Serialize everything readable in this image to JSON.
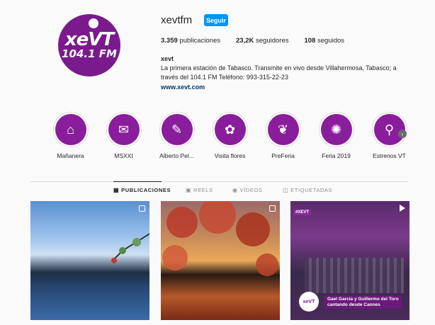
{
  "profile": {
    "username": "xevtfm",
    "follow_label": "Seguir",
    "avatar_brand": "xeVT",
    "avatar_freq": "104.1 FM",
    "stats": [
      {
        "value": "3.359",
        "label": "publicaciones"
      },
      {
        "value": "23,2K",
        "label": "seguidores"
      },
      {
        "value": "108",
        "label": "seguidos"
      }
    ],
    "bio_name": "xevt",
    "bio_text": "La primera estación de Tabasco. Transmite en vivo desde Villahermosa, Tabasco; a través del 104.1 FM Teléfono: 993-315-22-23",
    "bio_link": "www.xevt.com"
  },
  "highlights": [
    {
      "label": "Mañanera",
      "icon": "podium-icon",
      "glyph": "⌂"
    },
    {
      "label": "MSXXI",
      "icon": "chat-icon",
      "glyph": "✉"
    },
    {
      "label": "Alberto Pel...",
      "icon": "microphone-icon",
      "glyph": "✎"
    },
    {
      "label": "Visita flores",
      "icon": "flower-icon",
      "glyph": "✿"
    },
    {
      "label": "PreFeria",
      "icon": "leaf-icon",
      "glyph": "❦"
    },
    {
      "label": "Feria 2019",
      "icon": "ferris-wheel-icon",
      "glyph": "✺"
    },
    {
      "label": "Estrenos VT",
      "icon": "antenna-icon",
      "glyph": "⚲"
    }
  ],
  "tabs": [
    {
      "label": "PUBLICACIONES",
      "icon": "grid-icon",
      "glyph": "▦",
      "active": true
    },
    {
      "label": "REELS",
      "icon": "reels-icon",
      "glyph": "▣",
      "active": false
    },
    {
      "label": "VÍDEOS",
      "icon": "video-icon",
      "glyph": "◉",
      "active": false
    },
    {
      "label": "ETIQUETADAS",
      "icon": "tagged-icon",
      "glyph": "◫",
      "active": false
    }
  ],
  "posts": [
    {
      "type": "carousel"
    },
    {
      "type": "carousel"
    },
    {
      "type": "video",
      "tag": "#XEVT",
      "caption_line1": "Gael García y Guillermo del Toro",
      "caption_line2": "cantando desde Cannes",
      "logo": "xeVT"
    }
  ],
  "colors": {
    "brand_purple": "#7a1a8c",
    "follow_blue": "#0095f6"
  }
}
